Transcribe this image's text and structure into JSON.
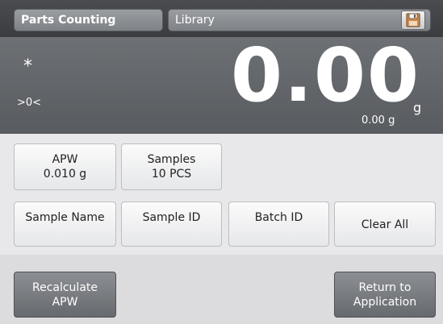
{
  "header": {
    "mode_label": "Parts Counting",
    "library_label": "Library",
    "save_icon": "floppy-disk-icon"
  },
  "display": {
    "stable_indicator": "*",
    "zero_indicator": ">0<",
    "main_value": "0.00",
    "unit": "g",
    "secondary_value": "0.00 g"
  },
  "buttons": {
    "apw": {
      "label": "APW",
      "value": "0.010 g"
    },
    "samples": {
      "label": "Samples",
      "value": "10 PCS"
    },
    "sample_name": "Sample Name",
    "sample_id": "Sample ID",
    "batch_id": "Batch ID",
    "clear_all": "Clear All"
  },
  "bottom": {
    "recalculate": {
      "line1": "Recalculate",
      "line2": "APW"
    },
    "return": {
      "line1": "Return to",
      "line2": "Application"
    }
  },
  "colors": {
    "header_bg": "#3f4144",
    "display_bg": "#626569",
    "panel_bg": "#e8e8ea",
    "bottom_button_bg": "#76797d"
  }
}
